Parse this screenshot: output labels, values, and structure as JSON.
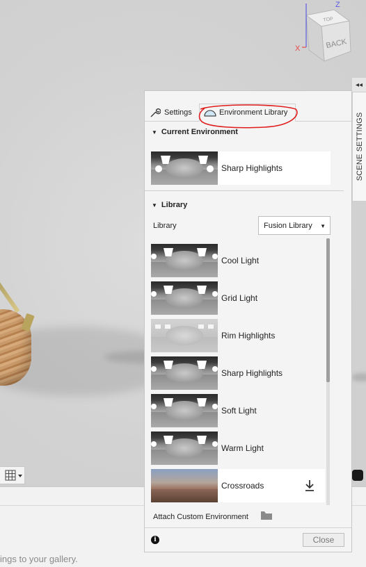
{
  "viewcube": {
    "face_label": "BACK",
    "top_label": "TOP",
    "axis_x": "X",
    "axis_z": "Z",
    "axis_x_color": "#e84a4a",
    "axis_z_color": "#5a5ae6"
  },
  "side_tab": {
    "label": "SCENE SETTINGS",
    "collapse_glyph": "◂◂"
  },
  "panel": {
    "tabs": [
      {
        "label": "Settings",
        "icon": "wrench-icon"
      },
      {
        "label": "Environment Library",
        "icon": "environment-dome-icon",
        "active": true
      }
    ],
    "current_environment": {
      "header": "Current Environment",
      "item": {
        "label": "Sharp Highlights",
        "thumb": "sharp"
      }
    },
    "library": {
      "header": "Library",
      "select_label": "Library",
      "select_value": "Fusion Library",
      "items": [
        {
          "label": "Cool Light",
          "thumb": "cool"
        },
        {
          "label": "Grid Light",
          "thumb": "grid"
        },
        {
          "label": "Rim Highlights",
          "thumb": "rim"
        },
        {
          "label": "Sharp Highlights",
          "thumb": "sharp"
        },
        {
          "label": "Soft Light",
          "thumb": "soft"
        },
        {
          "label": "Warm Light",
          "thumb": "warm"
        },
        {
          "label": "Crossroads",
          "thumb": "sky",
          "downloadable": true
        }
      ]
    },
    "attach_label": "Attach Custom Environment",
    "close_label": "Close",
    "annotation_color": "#e01b1b"
  },
  "bottom": {
    "gallery_text": "ings to your gallery."
  }
}
